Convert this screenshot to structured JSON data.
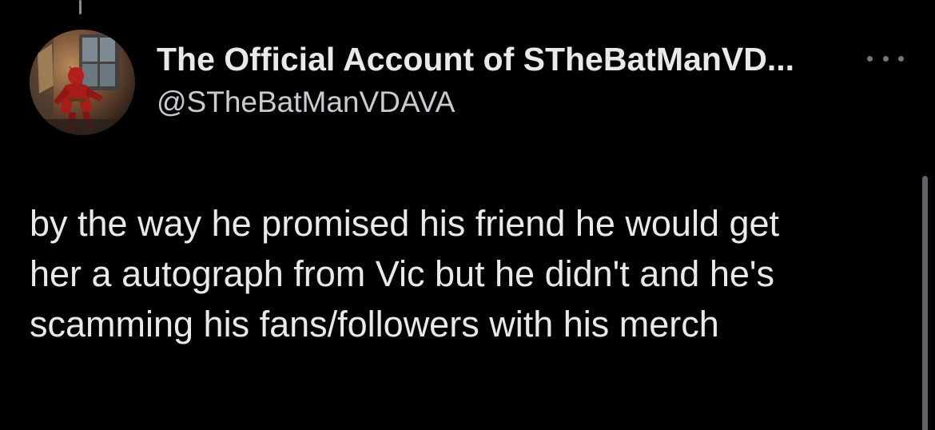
{
  "post": {
    "author": {
      "display_name": "The Official Account of STheBatManVD...",
      "handle": "@STheBatManVDAVA",
      "avatar_icon": "red-masked-hero-avatar"
    },
    "more_icon": "more-horizontal-icon",
    "text": "by the way he promised his friend he would get\nher a autograph from Vic but he didn't and he's\nscamming his fans/followers with his merch"
  },
  "colors": {
    "background": "#000000",
    "primary_text": "#e7e9ea",
    "secondary_text": "#71767b",
    "thread_line": "#8a8d91"
  }
}
